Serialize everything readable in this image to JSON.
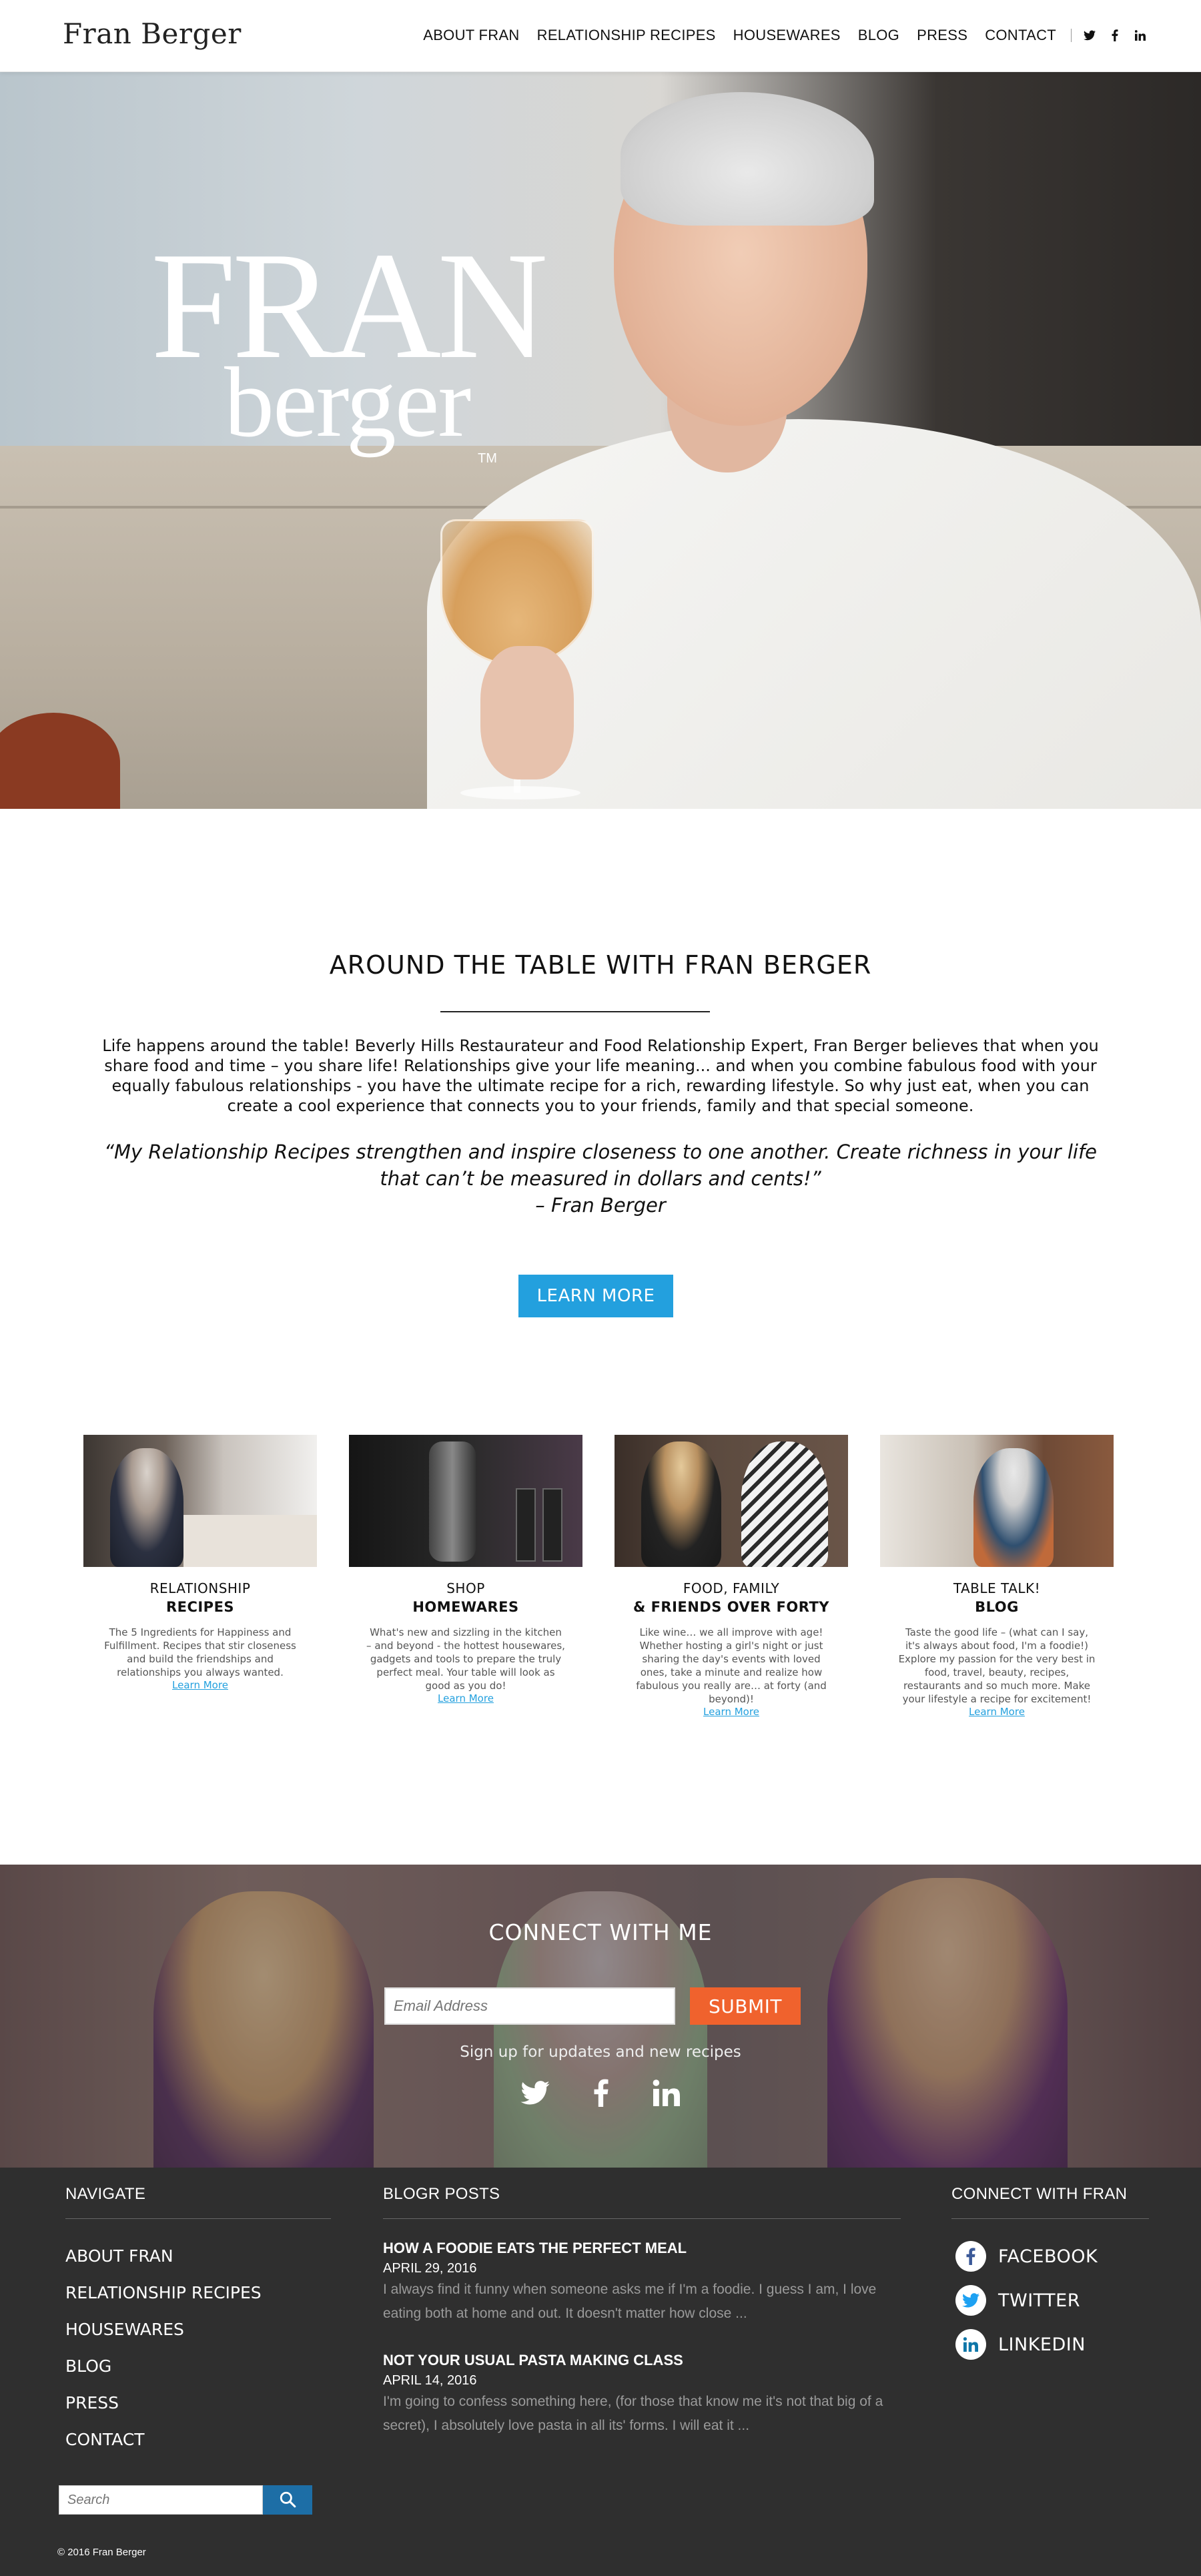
{
  "header": {
    "brand": "Fran Berger",
    "nav": [
      "ABOUT FRAN",
      "RELATIONSHIP RECIPES",
      "HOUSEWARES",
      "BLOG",
      "PRESS",
      "CONTACT"
    ],
    "social_icons": [
      "twitter-icon",
      "facebook-icon",
      "linkedin-icon"
    ]
  },
  "hero": {
    "logo_line1": "FRAN",
    "logo_line2": "berger",
    "logo_tm": "TM"
  },
  "about": {
    "title": "AROUND THE TABLE WITH FRAN BERGER",
    "body": "Life happens around the table! Beverly Hills Restaurateur and Food Relationship Expert, Fran Berger believes that when you share food and time – you share life!  Relationships give your life meaning... and when you combine fabulous food with your equally fabulous relationships - you have the ultimate recipe for a rich, rewarding lifestyle. So why just eat, when you can create a cool experience that connects you to your friends, family and that special someone.",
    "quote": "“My Relationship Recipes strengthen and inspire closeness to one another. Create richness in your life that can’t be measured in dollars and cents!”",
    "quote_author": "– Fran Berger",
    "button": "LEARN MORE"
  },
  "cards": [
    {
      "line1": "RELATIONSHIP",
      "line2": "RECIPES",
      "desc": "The 5 Ingredients for Happiness and Fulfillment. Recipes that stir closeness and build the friendships and relationships you always wanted.",
      "more": "Learn More"
    },
    {
      "line1": "SHOP",
      "line2": "HOMEWARES",
      "desc": "What's new and sizzling in the kitchen – and beyond - the hottest housewares, gadgets and tools to prepare the truly perfect meal.  Your table will look as good as you do!",
      "more": "Learn More"
    },
    {
      "line1": "FOOD, FAMILY",
      "line2": "& FRIENDS OVER FORTY",
      "desc": "Like wine… we all improve with age! Whether hosting a girl's night or just sharing the day's events with loved ones, take a minute and realize how fabulous you really are… at forty (and beyond)!",
      "more": "Learn More"
    },
    {
      "line1": "TABLE TALK!",
      "line2": "BLOG",
      "desc": "Taste the good life – (what can I say, it's always about food, I'm a foodie!) Explore my passion for the very best in food, travel, beauty, recipes, restaurants and so much more. Make your lifestyle a recipe for excitement!",
      "more": "Learn More"
    }
  ],
  "connect": {
    "title": "CONNECT WITH ME",
    "email_placeholder": "Email Address",
    "submit": "SUBMIT",
    "signup": "Sign up for updates and new recipes"
  },
  "footer": {
    "navigate_title": "NAVIGATE",
    "navigate": [
      "ABOUT FRAN",
      "RELATIONSHIP RECIPES",
      "HOUSEWARES",
      "BLOG",
      "PRESS",
      "CONTACT"
    ],
    "posts_title": "BLOGR POSTS",
    "posts": [
      {
        "title": "HOW A FOODIE EATS THE PERFECT MEAL",
        "date": "APRIL 29, 2016",
        "excerpt": "I always find it funny when someone asks me if I'm a foodie.  I guess I am, I love eating both at home and out.  It doesn't matter how close ..."
      },
      {
        "title": "NOT YOUR USUAL PASTA MAKING CLASS",
        "date": "APRIL 14, 2016",
        "excerpt": "I'm going to confess something here, (for those that know me it's not that big of a secret), I absolutely love pasta in all its' forms.  I will eat it ..."
      }
    ],
    "connect_title": "CONNECT WITH FRAN",
    "social": [
      "FACEBOOK",
      "TWITTER",
      "LINKEDIN"
    ],
    "search_placeholder": "Search",
    "copyright": "© 2016 Fran Berger"
  },
  "colors": {
    "accent_blue": "#23a0de",
    "submit_orange": "#f0622d",
    "footer_bg": "#2f2f2f",
    "search_btn": "#1d6ea6"
  }
}
